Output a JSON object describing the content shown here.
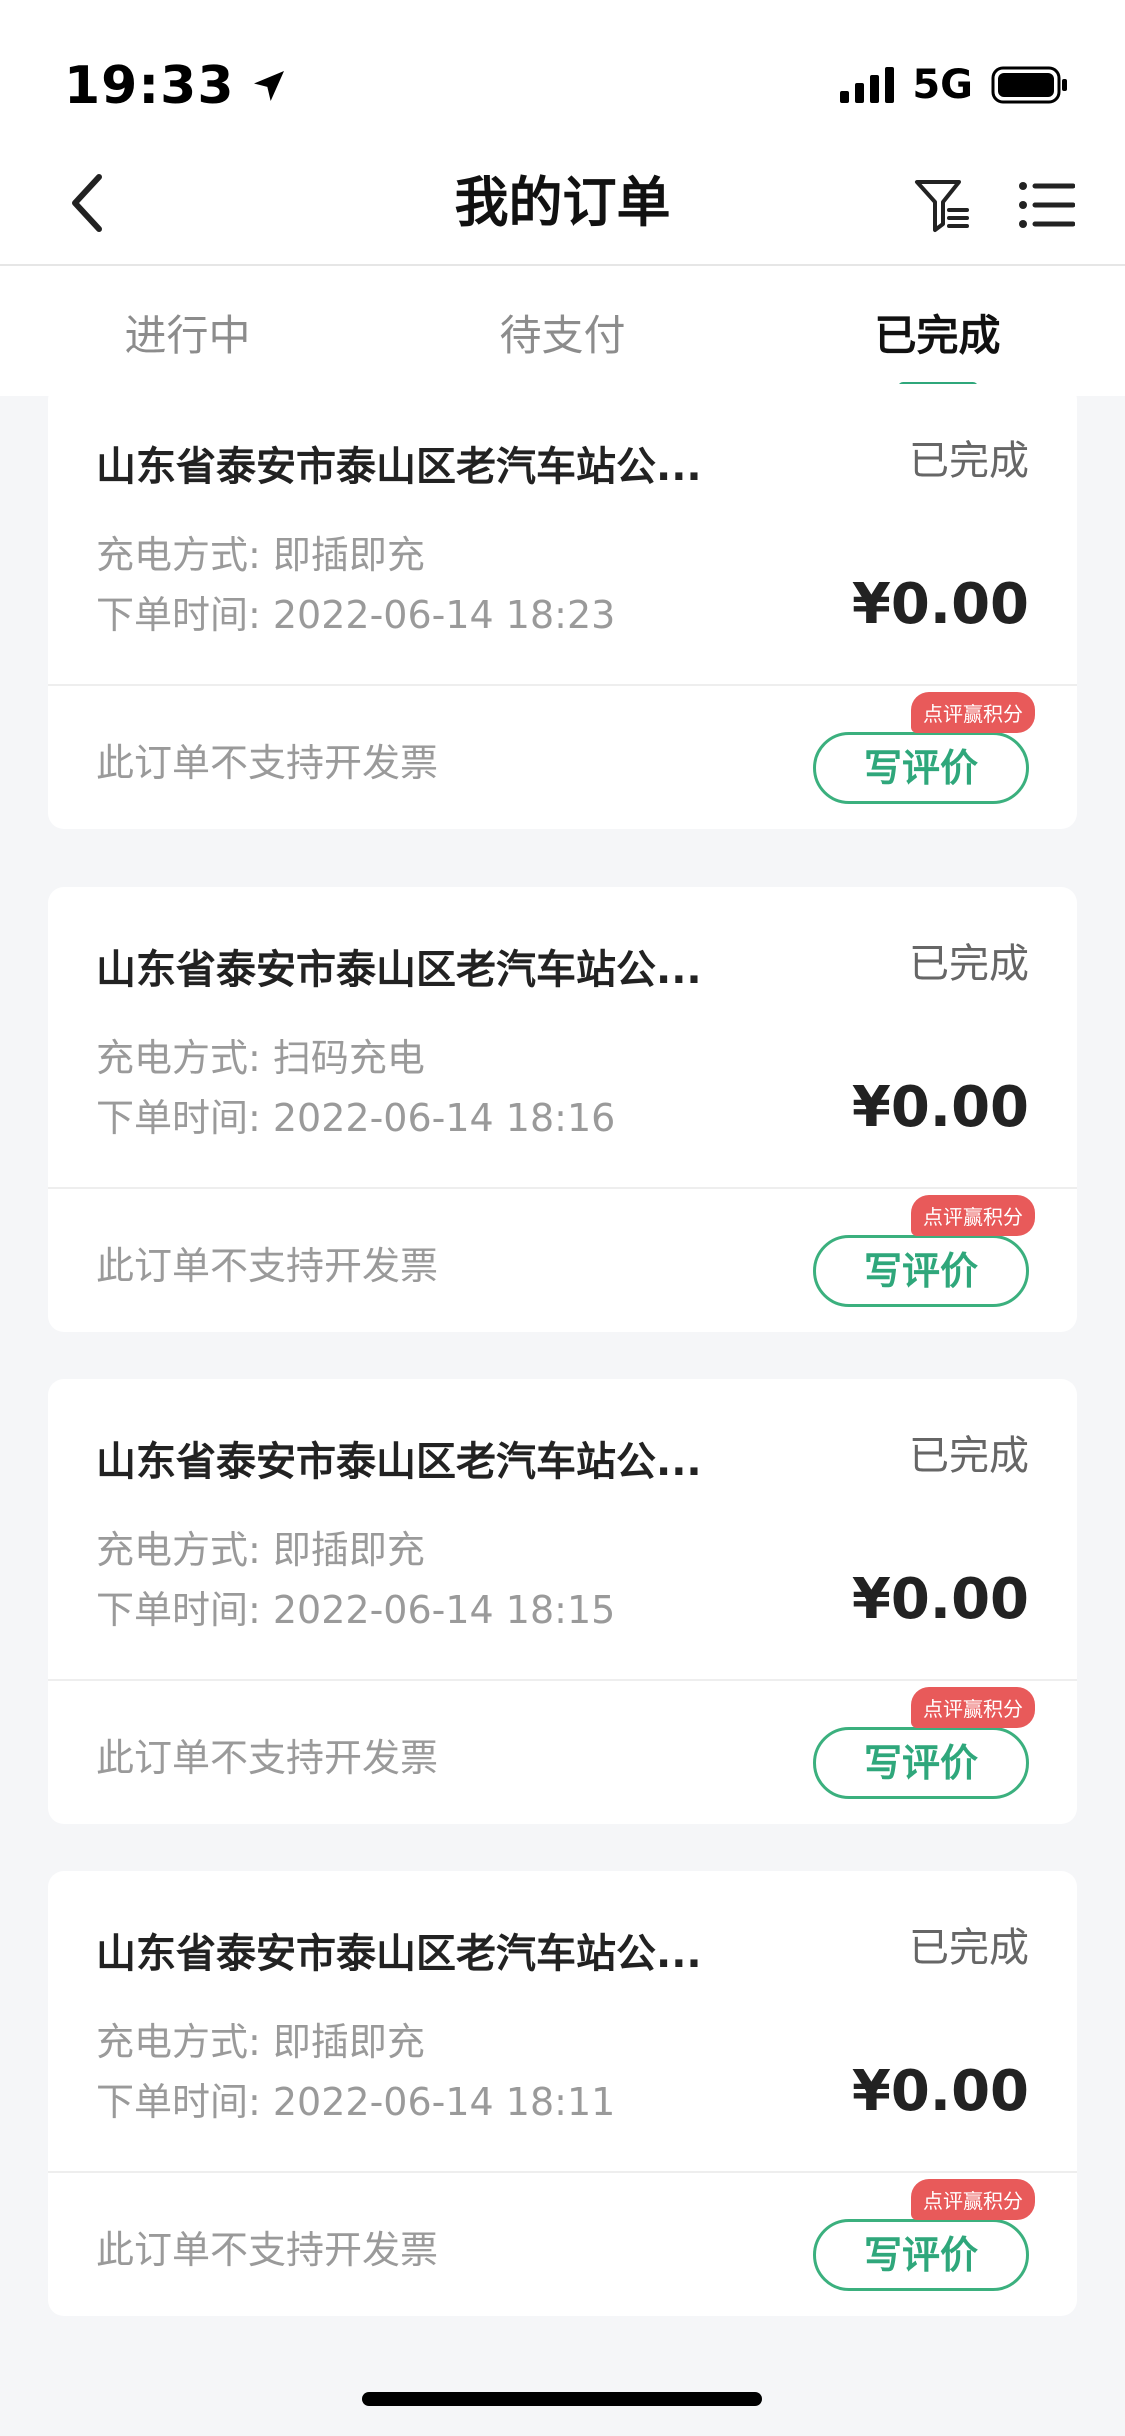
{
  "status_bar": {
    "time": "19:33",
    "network": "5G",
    "location_icon": "location-arrow-icon",
    "signal_icon": "signal-icon",
    "battery_icon": "battery-icon"
  },
  "nav": {
    "title": "我的订单",
    "back_icon": "chevron-left-icon",
    "filter_icon": "filter-icon",
    "menu_icon": "list-menu-icon"
  },
  "tabs": [
    {
      "label": "进行中",
      "active": false
    },
    {
      "label": "待支付",
      "active": false
    },
    {
      "label": "已完成",
      "active": true
    }
  ],
  "colors": {
    "accent": "#2fa77b",
    "badge": "#e85a5a",
    "background": "#f5f6f8"
  },
  "orders": [
    {
      "station": "山东省泰安市泰山区老汽车站公...",
      "status": "已完成",
      "charge_mode": "充电方式: 即插即充",
      "order_time": "下单时间: 2022-06-14 18:23",
      "price": "¥0.00",
      "invoice_note": "此订单不支持开发票",
      "review_label": "写评价",
      "badge": "点评赢积分"
    },
    {
      "station": "山东省泰安市泰山区老汽车站公...",
      "status": "已完成",
      "charge_mode": "充电方式: 扫码充电",
      "order_time": "下单时间: 2022-06-14 18:16",
      "price": "¥0.00",
      "invoice_note": "此订单不支持开发票",
      "review_label": "写评价",
      "badge": "点评赢积分"
    },
    {
      "station": "山东省泰安市泰山区老汽车站公...",
      "status": "已完成",
      "charge_mode": "充电方式: 即插即充",
      "order_time": "下单时间: 2022-06-14 18:15",
      "price": "¥0.00",
      "invoice_note": "此订单不支持开发票",
      "review_label": "写评价",
      "badge": "点评赢积分"
    },
    {
      "station": "山东省泰安市泰山区老汽车站公...",
      "status": "已完成",
      "charge_mode": "充电方式: 即插即充",
      "order_time": "下单时间: 2022-06-14 18:11",
      "price": "¥0.00",
      "invoice_note": "此订单不支持开发票",
      "review_label": "写评价",
      "badge": "点评赢积分"
    }
  ]
}
